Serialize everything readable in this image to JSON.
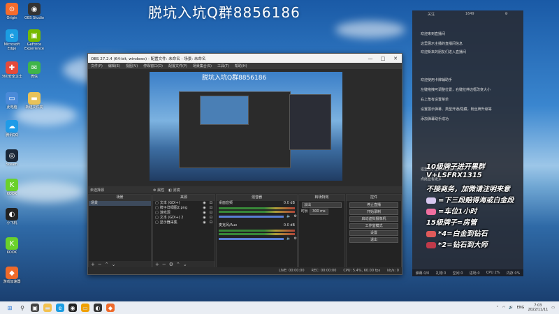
{
  "overlay_title": "脱坑入坑Q群8856186",
  "desktop": {
    "icons": [
      {
        "label": "Origin",
        "color": "#f56c2d",
        "glyph": "⊙"
      },
      {
        "label": "OBS Studio",
        "color": "#333333",
        "glyph": "◉"
      },
      {
        "label": "Microsoft Edge",
        "color": "#1b9de2",
        "glyph": "e"
      },
      {
        "label": "GeForce Experience",
        "color": "#76b900",
        "glyph": "▣"
      },
      {
        "label": "360安全卫士",
        "color": "#e64a3b",
        "glyph": "✚"
      },
      {
        "label": "微信",
        "color": "#3fb54a",
        "glyph": "✉"
      },
      {
        "label": "此电脑",
        "color": "#4a8ad8",
        "glyph": "▭"
      },
      {
        "label": "新建文件夹",
        "color": "#e8c25a",
        "glyph": "▬"
      },
      {
        "label": "腾讯QQ",
        "color": "#1f9be8",
        "glyph": "☁"
      },
      {
        "label": "Steam",
        "color": "#1b2838",
        "glyph": "◎"
      },
      {
        "label": "KOOK",
        "color": "#6ad12b",
        "glyph": "K"
      },
      {
        "label": "小飞机",
        "color": "#222222",
        "glyph": "◐"
      },
      {
        "label": "KOOK",
        "color": "#6ad12b",
        "glyph": "K"
      },
      {
        "label": "游戏加速器",
        "color": "#ef6a2a",
        "glyph": "◆"
      }
    ]
  },
  "obs": {
    "title": "OBS 27.2.4 (64-bit, windows) - 配置文件: 未命名 - 场景: 未命名",
    "menu": [
      "文件(F)",
      "编辑(E)",
      "视图(V)",
      "停靠窗口(D)",
      "配置文件(P)",
      "场景集合(S)",
      "工具(T)",
      "帮助(H)"
    ],
    "preview_caption": "脱坑入坑Q群8856186",
    "scene_bar": {
      "selected": "未选择源",
      "properties": "属性",
      "filters": "滤镜"
    },
    "docks": {
      "scenes": {
        "title": "场景",
        "items": [
          "场景"
        ]
      },
      "sources": {
        "title": "来源",
        "items": [
          "文本 (GDI+)",
          "牌子详细图2.png",
          "游戏源",
          "文本 (GDI+) 2",
          "显示器采集"
        ]
      },
      "mixer": {
        "title": "混音器",
        "tracks": [
          {
            "name": "桌面音频",
            "level": "0.0 dB"
          },
          {
            "name": "麦克风/Aux",
            "level": "0.0 dB"
          }
        ]
      },
      "transitions": {
        "title": "转场特效",
        "type": "淡出",
        "duration_label": "时长",
        "duration": "300 ms"
      },
      "controls": {
        "title": "控件",
        "buttons": [
          "停止直播",
          "开始录制",
          "启动虚拟摄像机",
          "工作室模式",
          "设置",
          "退出"
        ]
      }
    },
    "status": {
      "live": "LIVE: 00:00:00",
      "rec": "REC: 00:00:00",
      "cpu": "CPU: 5.4%, 60.00 fps",
      "kb": "kb/s: 0"
    }
  },
  "chat": {
    "top": [
      "关注",
      "1649"
    ],
    "lines": [
      "欢迎来到直播间",
      "这里展示主播的直播间信息",
      "欢迎新来的朋友们进入直播间",
      "欢迎使用卡牌辅助手",
      "左键拖拽可调整位置，右键拉伸边框改变大小",
      "右上角有设置菜单",
      "设置展示弹幕、类型开通/隐藏，粉丝牌升级等",
      "添加弹幕助手成功",
      "这里展示主播的直播间信息",
      "点此查看更多"
    ],
    "bottom": [
      "弹幕 0/0",
      "礼物 0",
      "空间 0",
      "进场 0",
      "CPU 2%",
      "内存 0%"
    ]
  },
  "promo": {
    "lines": [
      {
        "text": "10级牌子进开黑群"
      },
      {
        "text": "V+LSFRX1315"
      },
      {
        "text": "不接商务，加微请注明来意"
      },
      {
        "text": "=下三段赔得海或白金段",
        "gem": "#d8c8f0"
      },
      {
        "text": "=车位1小时",
        "gem": "#f06fa0"
      },
      {
        "text": "15级牌子=房管"
      },
      {
        "text": "*4=白金到钻石",
        "gem": "#e05a5a"
      },
      {
        "text": "*2=钻石到大师",
        "gem": "#c03a4a"
      }
    ]
  },
  "taskbar": {
    "tray": {
      "lang": "ENG",
      "time": "7:03",
      "date": "2022/11/11"
    }
  }
}
